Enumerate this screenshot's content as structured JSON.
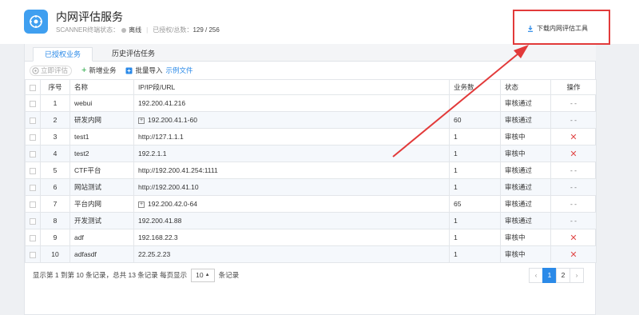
{
  "header": {
    "title": "内网评估服务",
    "scanner_label": "SCANNER终端状态：",
    "scanner_status": "离线",
    "authorized_label": "已授权/总数：",
    "authorized_value": "129 / 256",
    "download_label": "下载内网评估工具"
  },
  "tabs": [
    {
      "label": "已授权业务"
    },
    {
      "label": "历史评估任务"
    }
  ],
  "toolbar": {
    "evaluate_label": "立即评估",
    "add_label": "新增业务",
    "import_label": "批量导入",
    "sample_label": "示例文件"
  },
  "table": {
    "headers": [
      "序号",
      "名称",
      "IP/IP段/URL",
      "业务数",
      "状态",
      "操作"
    ],
    "rows": [
      {
        "no": "1",
        "name": "webui",
        "ip": "192.200.41.216",
        "count": "",
        "status": "审核通过",
        "op": "- -",
        "expand": false
      },
      {
        "no": "2",
        "name": "研发内网",
        "ip": "192.200.41.1-60",
        "count": "60",
        "status": "审核通过",
        "op": "- -",
        "expand": true
      },
      {
        "no": "3",
        "name": "test1",
        "ip": "http://127.1.1.1",
        "count": "1",
        "status": "审核中",
        "op": "✕",
        "expand": false
      },
      {
        "no": "4",
        "name": "test2",
        "ip": "192.2.1.1",
        "count": "1",
        "status": "审核中",
        "op": "✕",
        "expand": false
      },
      {
        "no": "5",
        "name": "CTF平台",
        "ip": "http://192.200.41.254:1111",
        "count": "1",
        "status": "审核通过",
        "op": "- -",
        "expand": false
      },
      {
        "no": "6",
        "name": "网站测试",
        "ip": "http://192.200.41.10",
        "count": "1",
        "status": "审核通过",
        "op": "- -",
        "expand": false
      },
      {
        "no": "7",
        "name": "平台内网",
        "ip": "192.200.42.0-64",
        "count": "65",
        "status": "审核通过",
        "op": "- -",
        "expand": true
      },
      {
        "no": "8",
        "name": "开发测试",
        "ip": "192.200.41.88",
        "count": "1",
        "status": "审核通过",
        "op": "- -",
        "expand": false
      },
      {
        "no": "9",
        "name": "adf",
        "ip": "192.168.22.3",
        "count": "1",
        "status": "审核中",
        "op": "✕",
        "expand": false
      },
      {
        "no": "10",
        "name": "adfasdf",
        "ip": "22.25.2.23",
        "count": "1",
        "status": "审核中",
        "op": "✕",
        "expand": false
      }
    ]
  },
  "footer": {
    "summary": "显示第 1 到第 10 条记录，总共 13 条记录 每页显示",
    "page_size": "10",
    "unit": "条记录"
  },
  "pager": {
    "prev": "‹",
    "pages": [
      "1",
      "2"
    ],
    "next": "›",
    "active": "1"
  },
  "colors": {
    "accent": "#2b8ae8",
    "annotation": "#e23a3a",
    "add_green": "#27a844",
    "delete_red": "#e04848"
  }
}
